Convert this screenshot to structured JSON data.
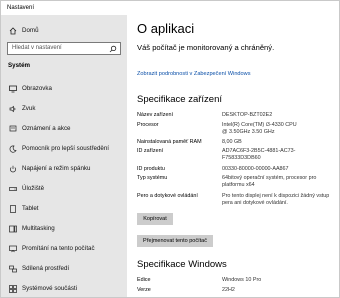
{
  "window": {
    "title": "Nastavení"
  },
  "sidebar": {
    "home": "Domů",
    "search_placeholder": "Hledat v nastavení",
    "section": "Systém",
    "items": [
      {
        "label": "Obrazovka",
        "icon": "monitor-icon"
      },
      {
        "label": "Zvuk",
        "icon": "speaker-icon"
      },
      {
        "label": "Oznámení a akce",
        "icon": "notification-icon"
      },
      {
        "label": "Pomocník pro lepší soustředění",
        "icon": "moon-icon"
      },
      {
        "label": "Napájení a režim spánku",
        "icon": "power-icon"
      },
      {
        "label": "Úložiště",
        "icon": "storage-icon"
      },
      {
        "label": "Tablet",
        "icon": "tablet-icon"
      },
      {
        "label": "Multitasking",
        "icon": "multitasking-icon"
      },
      {
        "label": "Promítání na tento počítač",
        "icon": "projecting-icon"
      },
      {
        "label": "Sdílená prostředí",
        "icon": "shared-icon"
      },
      {
        "label": "Systémové součásti",
        "icon": "components-icon"
      }
    ]
  },
  "main": {
    "title": "O aplikaci",
    "status": "Váš počítač je monitorovaný a chráněný.",
    "details_link": "Zobrazit podrobnosti v Zabezpečení Windows",
    "device_specs_title": "Specifikace zařízení",
    "device_specs": [
      {
        "key": "Název zařízení",
        "value": "DESKTOP-BZT02E2"
      },
      {
        "key": "Procesor",
        "value": "Intel(R) Core(TM) i3-4330 CPU @ 3.50GHz   3.50 GHz"
      },
      {
        "key": "Nainstalovaná paměť RAM",
        "value": "8,00 GB"
      },
      {
        "key": "ID zařízení",
        "value": "AD7AC6F3-2B5C-4881-AC73-F75833D3DB60"
      },
      {
        "key": "ID produktu",
        "value": "00330-80000-00000-AA867"
      },
      {
        "key": "Typ systému",
        "value": "64bitový operační systém, procesor pro platformu x64"
      },
      {
        "key": "Pero a dotykové ovládání",
        "value": "Pro tento displej není k dispozici žádný vstup pera ani dotykové ovládání."
      }
    ],
    "copy_button": "Kopírovat",
    "rename_button": "Přejmenovat tento počítač",
    "windows_specs_title": "Specifikace Windows",
    "windows_specs": [
      {
        "key": "Edice",
        "value": "Windows 10 Pro"
      },
      {
        "key": "Verze",
        "value": "22H2"
      }
    ]
  }
}
